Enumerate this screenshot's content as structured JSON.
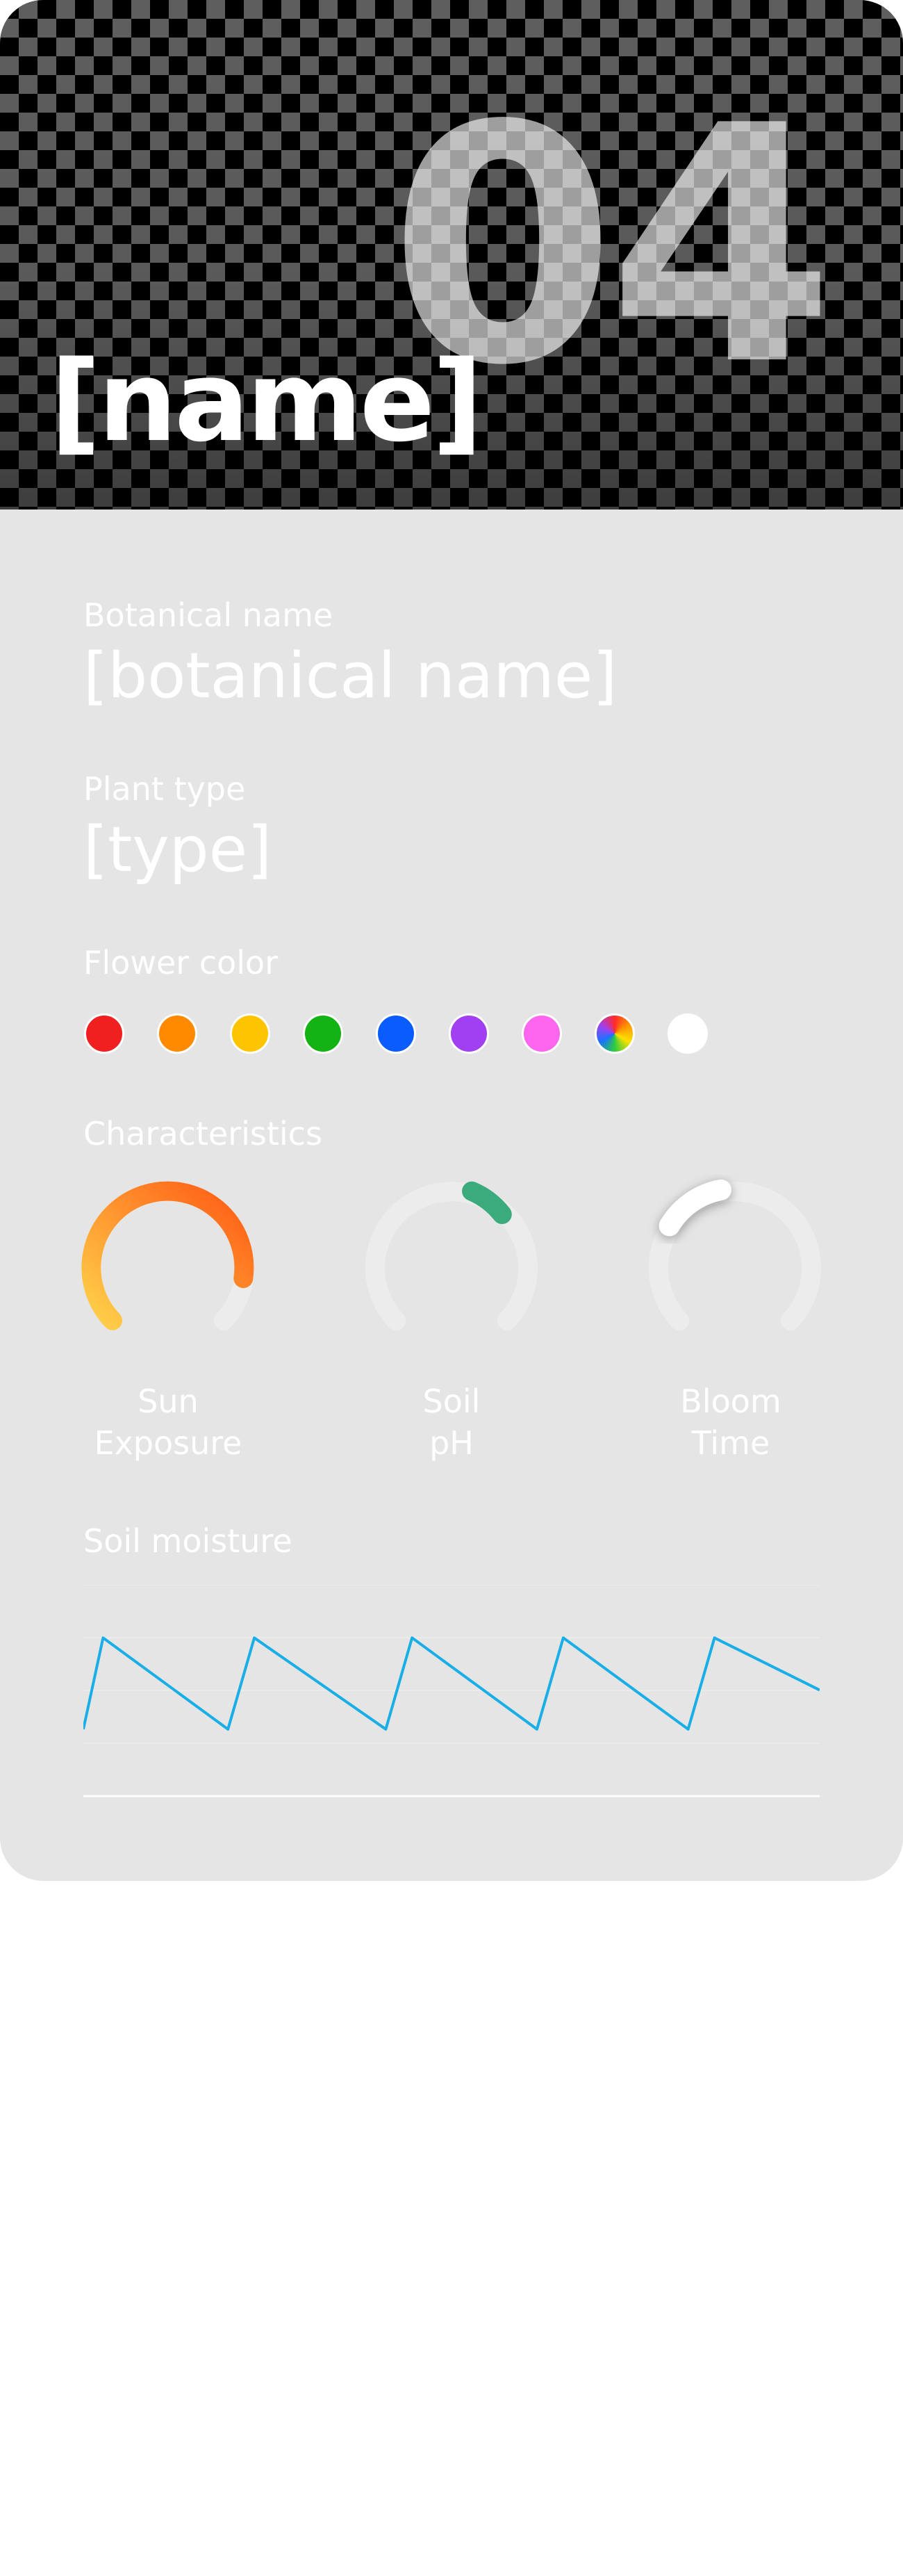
{
  "header": {
    "number": "04",
    "name": "[name]"
  },
  "botanical": {
    "label": "Botanical name",
    "value": "[botanical name]"
  },
  "plant_type": {
    "label": "Plant type",
    "value": "[type]"
  },
  "flower_color": {
    "label": "Flower color",
    "swatches": [
      "#f02020",
      "#ff8a00",
      "#ffc400",
      "#12b312",
      "#0a5cff",
      "#a040f0",
      "#ff66ee",
      "multicolor",
      "#ffffff"
    ]
  },
  "characteristics": {
    "label": "Characteristics",
    "gauges": [
      {
        "label_line1": "Sun",
        "label_line2": "Exposure",
        "color_start": "#ffd04a",
        "color_end": "#ff5a14"
      },
      {
        "label_line1": "Soil",
        "label_line2": "pH",
        "color": "#3bab7e"
      },
      {
        "label_line1": "Bloom",
        "label_line2": "Time",
        "color": "#ffffff"
      }
    ]
  },
  "soil_moisture": {
    "label": "Soil moisture",
    "line_color": "#1aaee6"
  },
  "chart_data": {
    "type": "line",
    "title": "Soil moisture",
    "xlabel": "",
    "ylabel": "",
    "grid": true,
    "x": [
      0,
      3,
      22,
      26,
      46,
      50,
      69,
      73,
      92,
      96,
      112
    ],
    "series": [
      {
        "values": [
          0.3,
          1.0,
          0.3,
          1.0,
          0.3,
          1.0,
          0.3,
          1.0,
          0.3,
          1.0,
          0.6
        ]
      }
    ],
    "ylim": [
      0,
      1.3
    ]
  }
}
